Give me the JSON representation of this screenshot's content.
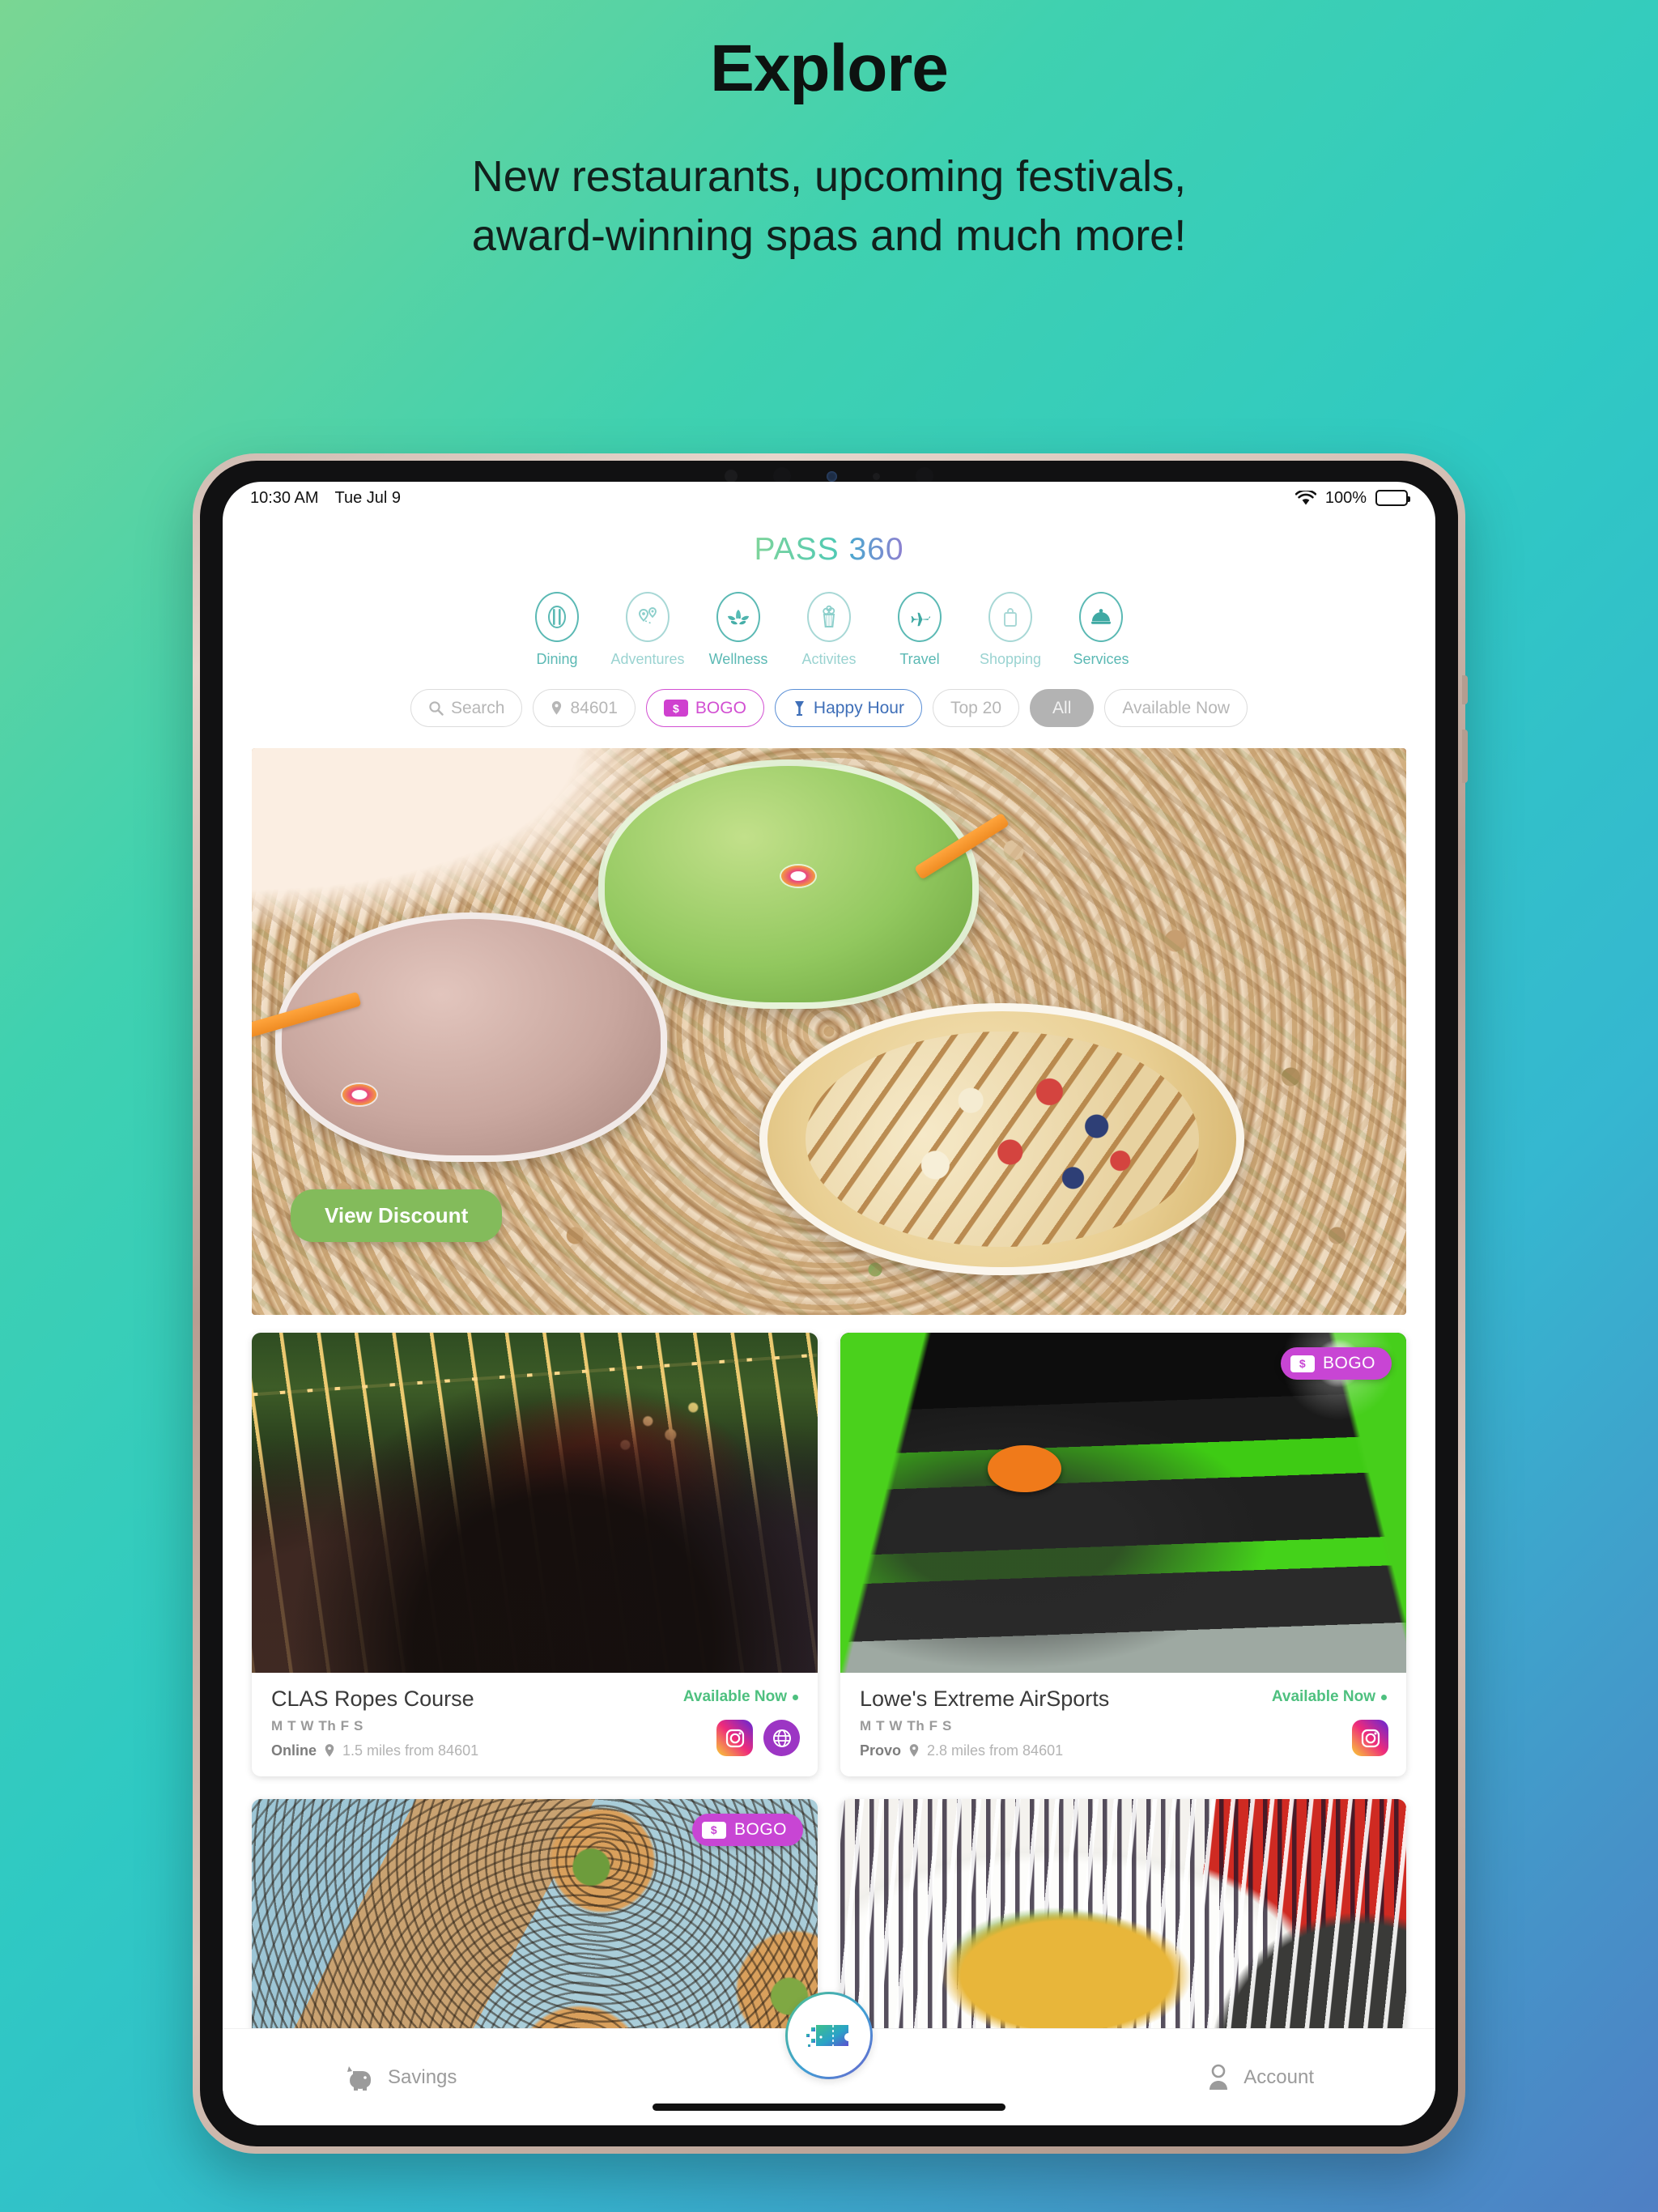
{
  "promo": {
    "title": "Explore",
    "subtitle_line1": "New restaurants, upcoming festivals,",
    "subtitle_line2": "award-winning spas and much more!"
  },
  "status_bar": {
    "time": "10:30 AM",
    "date": "Tue Jul 9",
    "battery_percent": "100%",
    "wifi_icon": "wifi-icon",
    "battery_icon": "battery-full-icon"
  },
  "app": {
    "logo_word1": "PASS",
    "logo_word2": "360",
    "brand_green": "#5bb9b4",
    "brand_purple": "#8e7fd0"
  },
  "categories": [
    {
      "label": "Dining",
      "icon": "plate-fork-icon"
    },
    {
      "label": "Adventures",
      "icon": "map-pins-icon"
    },
    {
      "label": "Wellness",
      "icon": "lotus-icon"
    },
    {
      "label": "Activites",
      "icon": "popcorn-icon"
    },
    {
      "label": "Travel",
      "icon": "airplane-icon"
    },
    {
      "label": "Shopping",
      "icon": "shopping-bag-icon"
    },
    {
      "label": "Services",
      "icon": "service-bell-icon"
    }
  ],
  "filters": [
    {
      "label": "Search",
      "icon": "search-icon",
      "state": "default"
    },
    {
      "label": "84601",
      "icon": "location-pin-icon",
      "state": "default"
    },
    {
      "label": "BOGO",
      "icon": "dollar-tag-icon",
      "state": "bogo"
    },
    {
      "label": "Happy Hour",
      "icon": "cocktail-glass-icon",
      "state": "happy"
    },
    {
      "label": "Top 20",
      "icon": "",
      "state": "default"
    },
    {
      "label": "All",
      "icon": "",
      "state": "selected"
    },
    {
      "label": "Available Now",
      "icon": "",
      "state": "default"
    }
  ],
  "hero": {
    "button_label": "View Discount",
    "button_color": "#83bb5b",
    "alt": "smoothies and acai bowl on bed of mixed nuts"
  },
  "cards": [
    {
      "title": "CLAS Ropes Course",
      "days": "M T W Th F S",
      "city": "Online",
      "distance": "1.5 miles from 84601",
      "availability": "Available Now",
      "badge": "",
      "socials": [
        "instagram-icon",
        "website-globe-icon"
      ],
      "image": "outdoor evening festival with string lights"
    },
    {
      "title": "Lowe's Extreme AirSports",
      "days": "M T W Th F S",
      "city": "Provo",
      "distance": "2.8 miles from 84601",
      "availability": "Available Now",
      "badge": "BOGO",
      "socials": [
        "instagram-icon"
      ],
      "image": "indoor trampoline park dodgeball"
    },
    {
      "title": "",
      "days": "",
      "city": "",
      "distance": "",
      "availability": "",
      "badge": "BOGO",
      "socials": [],
      "image": "bagel sandwiches on wooden board"
    },
    {
      "title": "",
      "days": "",
      "city": "",
      "distance": "",
      "availability": "",
      "badge": "",
      "socials": [],
      "image": "mexican enchiladas plate with salsa"
    }
  ],
  "tabbar": {
    "left_label": "Savings",
    "left_icon": "piggy-bank-icon",
    "right_label": "Account",
    "right_icon": "person-icon",
    "center_icon": "ticket-icon"
  }
}
